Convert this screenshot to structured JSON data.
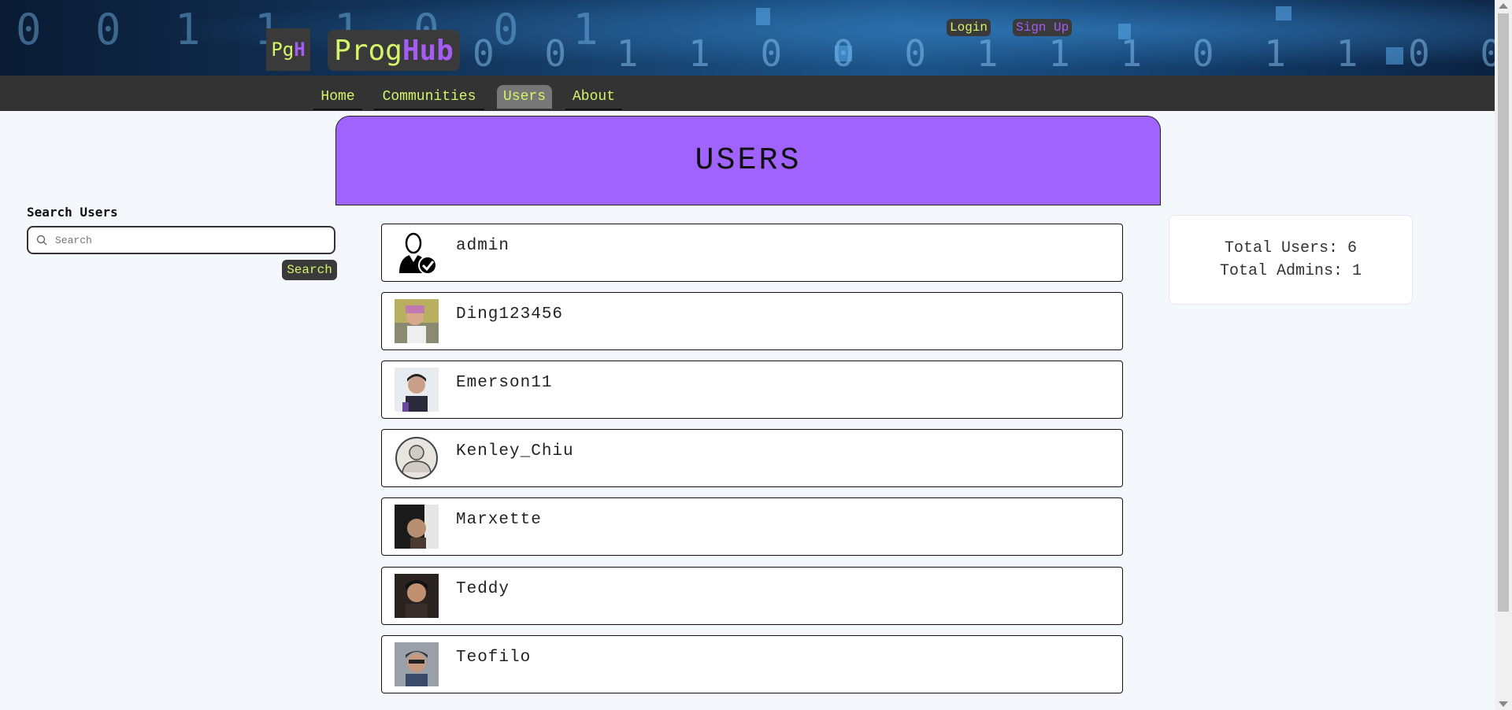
{
  "brand": {
    "square_left": "Pg",
    "square_right": "H",
    "wide_left": "Prog",
    "wide_right": "Hub"
  },
  "header": {
    "binary_row1": "0 0 1 1 1 0 0 1",
    "binary_row2": "0 0 1 1 0 0 0 1 1 1 0 1 1 0 0 1 0",
    "login_label": "Login",
    "signup_label": "Sign Up"
  },
  "nav": {
    "items": [
      {
        "label": "Home"
      },
      {
        "label": "Communities"
      },
      {
        "label": "Users"
      },
      {
        "label": "About"
      }
    ],
    "active": "Users"
  },
  "page": {
    "title": "USERS"
  },
  "search": {
    "label": "Search Users",
    "placeholder": "Search",
    "value": "",
    "button_label": "Search"
  },
  "users": [
    {
      "name": "admin",
      "avatar": "admin-verified-icon"
    },
    {
      "name": "Ding123456",
      "avatar": "photo"
    },
    {
      "name": "Emerson11",
      "avatar": "photo"
    },
    {
      "name": "Kenley_Chiu",
      "avatar": "default-person-icon"
    },
    {
      "name": "Marxette",
      "avatar": "photo"
    },
    {
      "name": "Teddy",
      "avatar": "photo"
    },
    {
      "name": "Teofilo",
      "avatar": "photo"
    }
  ],
  "stats": {
    "total_users_label": "Total Users: 6",
    "total_admins_label": "Total Admins: 1"
  },
  "colors": {
    "accent_green": "#d4f56a",
    "accent_purple": "#a55cf5",
    "header_purple": "#a163fd",
    "nav_bg": "#333333"
  }
}
